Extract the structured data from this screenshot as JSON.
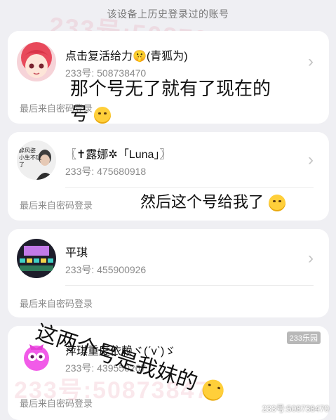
{
  "header": {
    "title": "该设备上历史登录过的账号"
  },
  "accounts": [
    {
      "nickname": "点击复活给力🤫(青狐为)",
      "account": "233号: 508738470",
      "login_method": "最后来自密码登录"
    },
    {
      "nickname": "〖✝露娜✲「Luna」〗",
      "account": "233号: 475680918",
      "login_method": "最后来自密码登录"
    },
    {
      "nickname": "平琪",
      "account": "233号: 455900926",
      "login_method": "最后来自密码登录"
    },
    {
      "nickname": "萍琪重度依赖ヾ(ˊvˋ)ゞ",
      "account": "233号: 439550267",
      "login_method": "最后来自密码登录"
    }
  ],
  "annotations": {
    "note1_line1": "那个号无了就有了现在的",
    "note1_line2": "号",
    "note2": "然后这个号给我了",
    "note3": "这两个号是我妹的"
  },
  "avatar_text": {
    "second_line1": "醉风姿",
    "second_line2": "小生不玩",
    "second_line3": "了"
  },
  "watermark": {
    "top": "233号:508738470",
    "bottom": "233号:508738470",
    "corner": "233号:508738470",
    "brand": "233乐园"
  },
  "icons": {
    "chevron": "chevron-right-icon"
  }
}
